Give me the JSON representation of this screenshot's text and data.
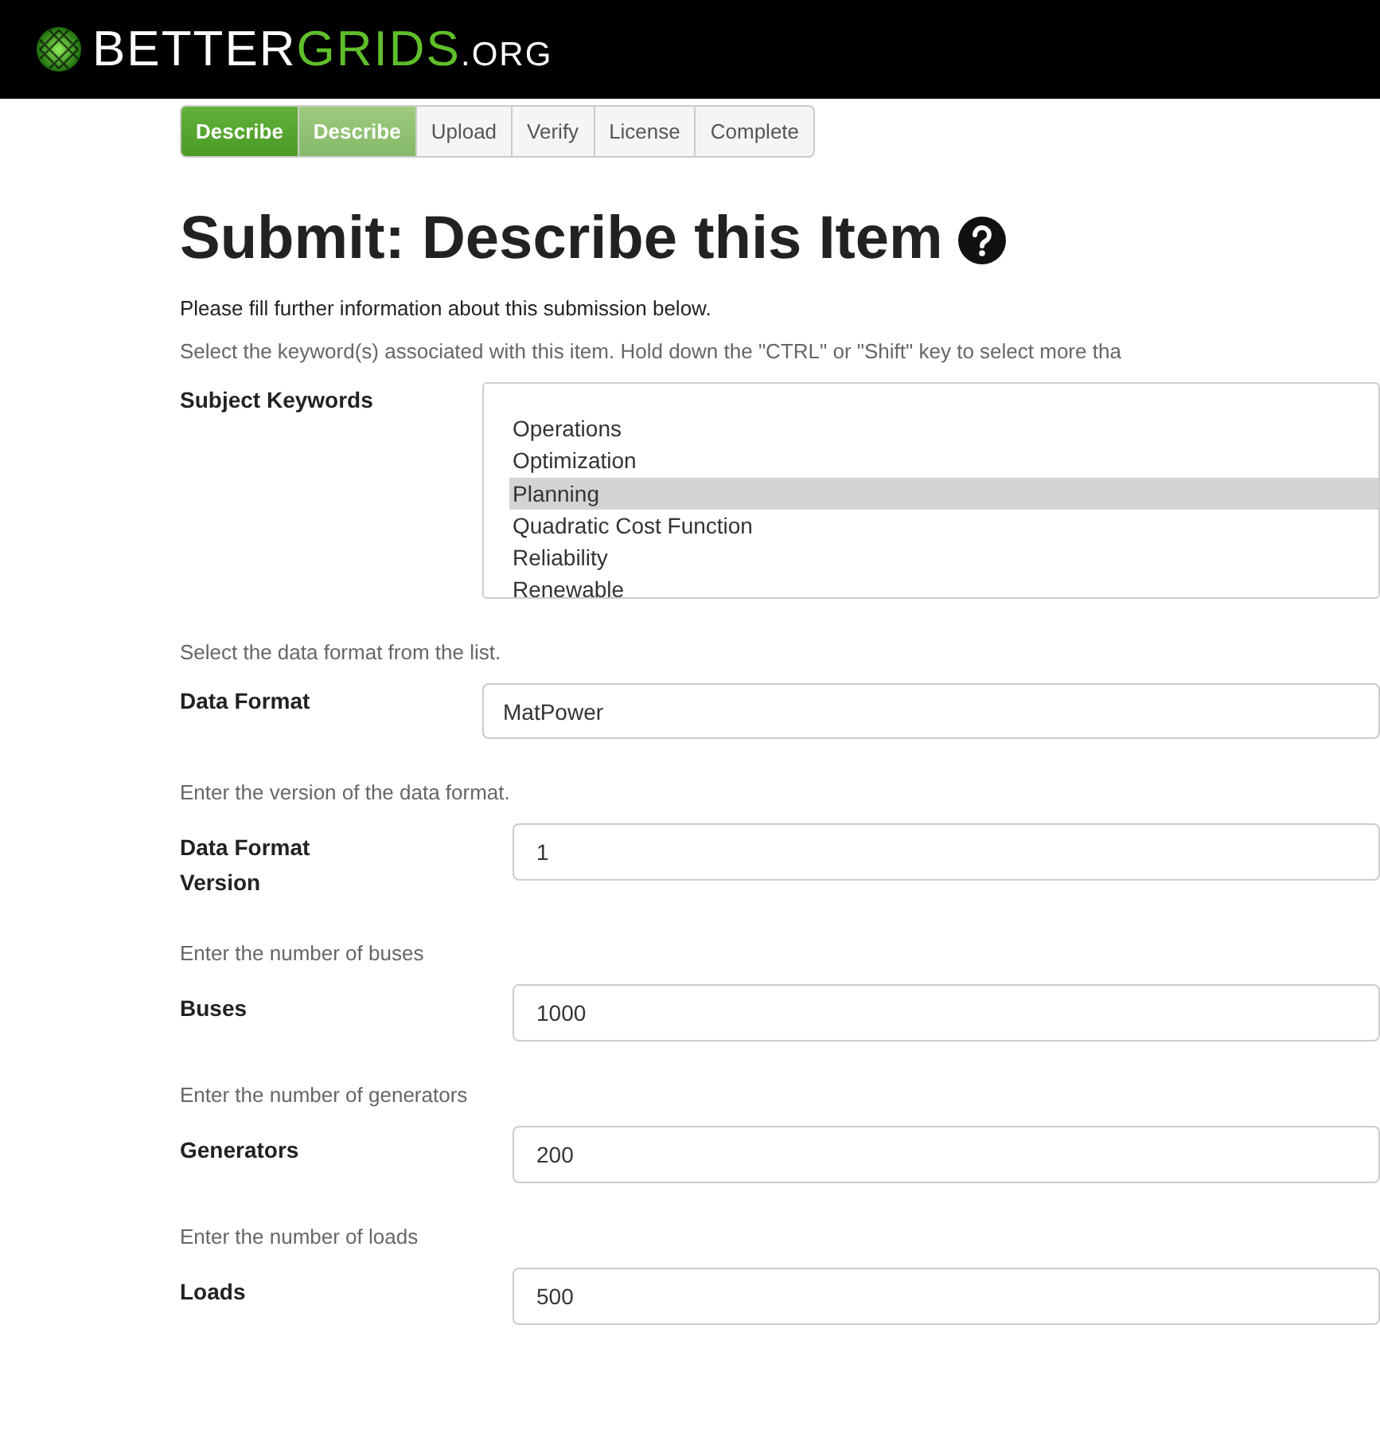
{
  "header": {
    "logo": [
      {
        "text": "BETTER",
        "kind": "plain"
      },
      {
        "text": "GRIDS",
        "kind": "accent"
      },
      {
        "text": ".ORG",
        "kind": "small"
      }
    ]
  },
  "steps": [
    {
      "label": "Describe",
      "selected": false,
      "completed": true
    },
    {
      "label": "Describe",
      "selected": true,
      "completed": false
    },
    {
      "label": "Upload",
      "selected": false,
      "completed": false
    },
    {
      "label": "Verify",
      "selected": false,
      "completed": false
    },
    {
      "label": "License",
      "selected": false,
      "completed": false
    },
    {
      "label": "Complete",
      "selected": false,
      "completed": false
    }
  ],
  "title": "Submit: Describe this Item",
  "intro": "Please fill further information about this submission below.",
  "fields": [
    {
      "kind": "listbox",
      "hint": "Select the keyword(s) associated with this item. Hold down the \"CTRL\" or \"Shift\" key to select more tha",
      "label": "Subject Keywords",
      "options": [
        {
          "label": "Operations",
          "selected": false
        },
        {
          "label": "Optimization",
          "selected": false
        },
        {
          "label": "Planning",
          "selected": true
        },
        {
          "label": "Quadratic Cost Function",
          "selected": false
        },
        {
          "label": "Reliability",
          "selected": false
        },
        {
          "label": "Renewable",
          "selected": false
        }
      ]
    },
    {
      "kind": "select",
      "hint": "Select the data format from the list.",
      "label": "Data Format",
      "value": "MatPower"
    },
    {
      "kind": "text",
      "hint": "Enter the version of the data format.",
      "label": "Data Format Version",
      "value": "1"
    },
    {
      "kind": "text",
      "hint": "Enter the number of buses",
      "label": "Buses",
      "value": "1000"
    },
    {
      "kind": "text",
      "hint": "Enter the number of generators",
      "label": "Generators",
      "value": "200"
    },
    {
      "kind": "text",
      "hint": "Enter the number of loads",
      "label": "Loads",
      "value": "500"
    }
  ]
}
